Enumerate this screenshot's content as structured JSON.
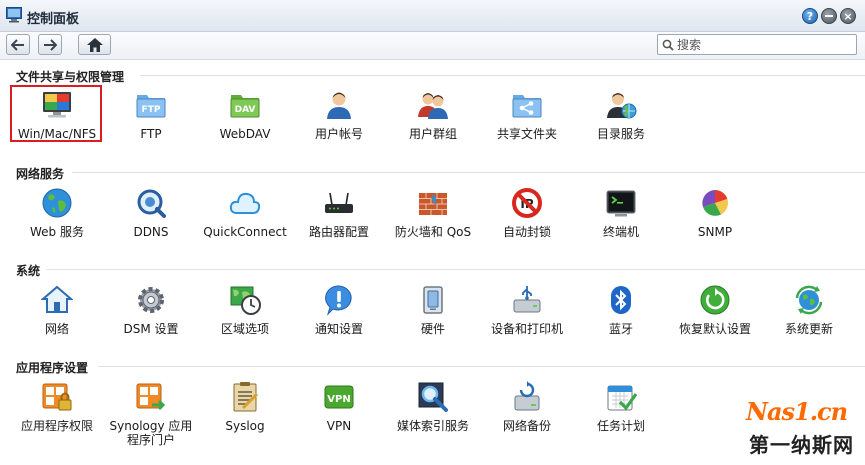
{
  "window": {
    "title": "控制面板",
    "help_label": "?",
    "close_label": "×"
  },
  "toolbar": {
    "search_placeholder": "搜索"
  },
  "sections": [
    {
      "title": "文件共享与权限管理",
      "items": [
        {
          "label": "Win/Mac/NFS",
          "icon": "monitor-icon",
          "selected": true
        },
        {
          "label": "FTP",
          "icon": "ftp-folder-icon"
        },
        {
          "label": "WebDAV",
          "icon": "dav-folder-icon"
        },
        {
          "label": "用户帐号",
          "icon": "user-icon"
        },
        {
          "label": "用户群组",
          "icon": "user-group-icon"
        },
        {
          "label": "共享文件夹",
          "icon": "shared-folder-icon"
        },
        {
          "label": "目录服务",
          "icon": "directory-service-icon"
        }
      ]
    },
    {
      "title": "网络服务",
      "items": [
        {
          "label": "Web 服务",
          "icon": "globe-icon"
        },
        {
          "label": "DDNS",
          "icon": "ddns-icon"
        },
        {
          "label": "QuickConnect",
          "icon": "cloud-icon"
        },
        {
          "label": "路由器配置",
          "icon": "router-icon"
        },
        {
          "label": "防火墙和 QoS",
          "icon": "firewall-icon"
        },
        {
          "label": "自动封锁",
          "icon": "block-icon"
        },
        {
          "label": "终端机",
          "icon": "terminal-icon"
        },
        {
          "label": "SNMP",
          "icon": "pie-chart-icon"
        }
      ]
    },
    {
      "title": "系统",
      "items": [
        {
          "label": "网络",
          "icon": "home-network-icon"
        },
        {
          "label": "DSM 设置",
          "icon": "gear-icon"
        },
        {
          "label": "区域选项",
          "icon": "clock-map-icon"
        },
        {
          "label": "通知设置",
          "icon": "notification-icon"
        },
        {
          "label": "硬件",
          "icon": "hardware-icon"
        },
        {
          "label": "设备和打印机",
          "icon": "usb-drive-icon"
        },
        {
          "label": "蓝牙",
          "icon": "bluetooth-icon"
        },
        {
          "label": "恢复默认设置",
          "icon": "restore-icon"
        },
        {
          "label": "系统更新",
          "icon": "system-update-icon"
        }
      ]
    },
    {
      "title": "应用程序设置",
      "items": [
        {
          "label": "应用程序权限",
          "icon": "app-privileges-icon"
        },
        {
          "label": "Synology 应用程序门户",
          "icon": "app-portal-icon"
        },
        {
          "label": "Syslog",
          "icon": "syslog-icon"
        },
        {
          "label": "VPN",
          "icon": "vpn-icon"
        },
        {
          "label": "媒体索引服务",
          "icon": "media-index-icon"
        },
        {
          "label": "网络备份",
          "icon": "network-backup-icon"
        },
        {
          "label": "任务计划",
          "icon": "task-scheduler-icon"
        }
      ]
    }
  ],
  "watermark": {
    "line1": "Nas1.cn",
    "line2": "第一纳斯网"
  }
}
